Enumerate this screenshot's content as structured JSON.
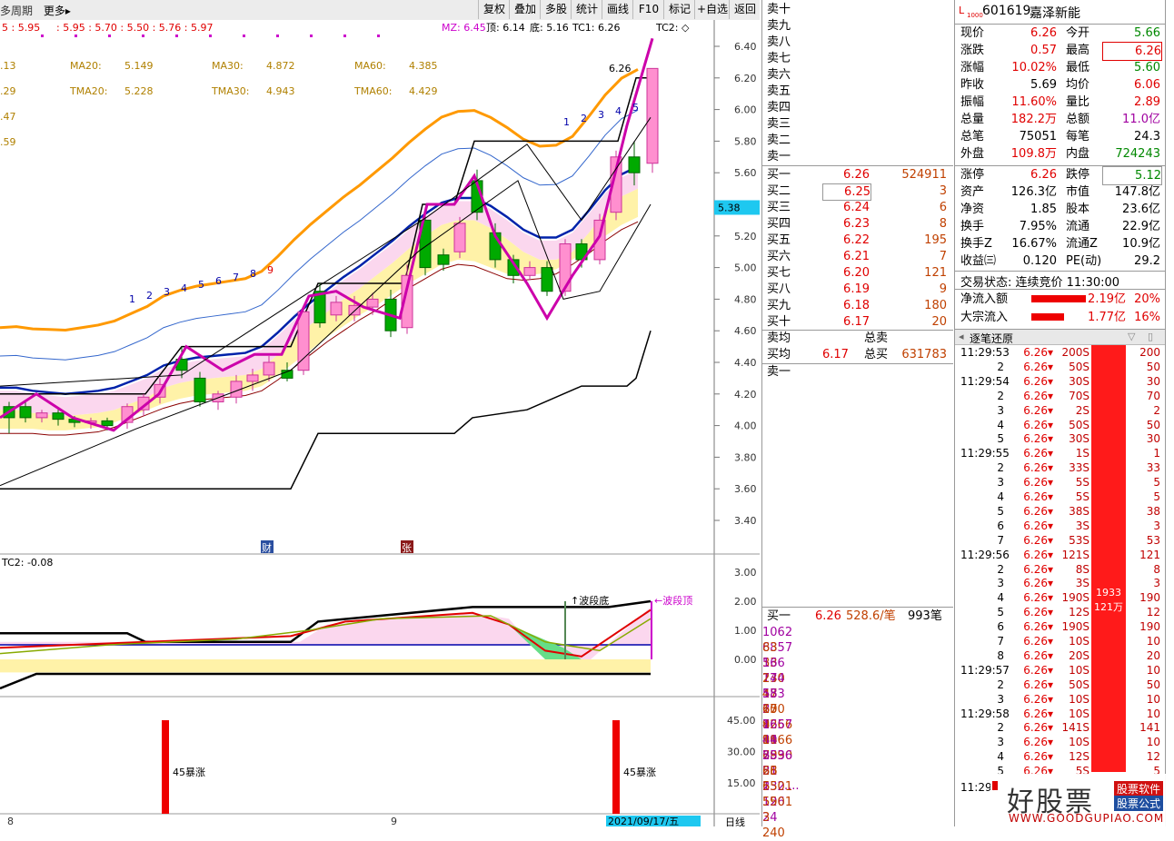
{
  "toolbar": {
    "period": "多周期",
    "more": "更多",
    "buttons": [
      "复权",
      "叠加",
      "多股",
      "统计",
      "画线",
      "F10",
      "标记",
      "+自选",
      "返回"
    ]
  },
  "main_chart": {
    "info_row1": [
      "5 : 5.95",
      ": 5.95 : 5.70 : 5.50 : 5.76 : 5.97",
      "MZ: 6.45",
      "顶: 6.14",
      "底: 5.16",
      "TC1: 6.26",
      "TC2: ◇"
    ],
    "ma_row1": [
      ".13",
      "MA20:",
      "5.149",
      "MA30:",
      "4.872",
      "MA60:",
      "4.385"
    ],
    "ma_row2": [
      ".29",
      "TMA20:",
      "5.228",
      "TMA30:",
      "4.943",
      "TMA60:",
      "4.429"
    ],
    "side_vals": [
      ".47",
      ".59"
    ],
    "price_ticks": [
      "6.40",
      "6.20",
      "6.00",
      "5.80",
      "5.60",
      "5.20",
      "5.00",
      "4.80",
      "4.60",
      "4.40",
      "4.20",
      "4.00",
      "3.80",
      "3.60",
      "3.40"
    ],
    "current_price_tag": "5.38",
    "high_label": "6.26",
    "seq_nums_left": [
      "1",
      "2",
      "3",
      "4",
      "5",
      "6",
      "7",
      "8",
      "9"
    ],
    "seq_nums_right": [
      "1",
      "2",
      "3",
      "4",
      "5"
    ],
    "marker_cai": "财",
    "marker_zhang": "张"
  },
  "sub_chart": {
    "title": "TC2: -0.08",
    "ticks": [
      "3.00",
      "2.00",
      "1.00",
      "0.00"
    ],
    "label_bottom": "波段底",
    "label_top": "波段顶"
  },
  "vol_chart": {
    "ticks": [
      "45.00",
      "30.00",
      "15.00"
    ],
    "label_a": "45暴涨",
    "label_b": "45暴涨",
    "bars": [
      45,
      45
    ]
  },
  "bottom_bar": {
    "date_a": "8",
    "date_b": "9",
    "date_current": "2021/09/17/五",
    "period": "日线"
  },
  "orderbook": {
    "sells": [
      "卖十",
      "卖九",
      "卖八",
      "卖七",
      "卖六",
      "卖五",
      "卖四",
      "卖三",
      "卖二",
      "卖一"
    ],
    "buys": [
      {
        "label": "买一",
        "price": "6.26",
        "vol": "524911"
      },
      {
        "label": "买二",
        "price": "6.25",
        "vol": "3"
      },
      {
        "label": "买三",
        "price": "6.24",
        "vol": "6"
      },
      {
        "label": "买四",
        "price": "6.23",
        "vol": "8"
      },
      {
        "label": "买五",
        "price": "6.22",
        "vol": "195"
      },
      {
        "label": "买六",
        "price": "6.21",
        "vol": "7"
      },
      {
        "label": "买七",
        "price": "6.20",
        "vol": "121"
      },
      {
        "label": "买八",
        "price": "6.19",
        "vol": "9"
      },
      {
        "label": "买九",
        "price": "6.18",
        "vol": "180"
      },
      {
        "label": "买十",
        "price": "6.17",
        "vol": "20"
      }
    ],
    "avg_sell_label": "卖均",
    "total_sell_label": "总卖",
    "avg_buy_label": "买均",
    "avg_buy": "6.17",
    "total_buy_label": "总买",
    "total_buy": "631783",
    "sell1_label": "卖一",
    "queue_header": {
      "label": "买一",
      "price": "6.26",
      "amount": "528.6/笔",
      "count": "993笔"
    },
    "queue_rows": [
      [
        "1062",
        "6857",
        "536",
        "74",
        "133"
      ],
      [
        "83",
        "33",
        "130",
        "47",
        "20"
      ],
      [
        "16",
        "174",
        "55",
        "6",
        "4"
      ],
      [
        "2",
        "48",
        "15",
        "82",
        "81"
      ],
      [
        "58",
        "3",
        "7",
        "39",
        "383"
      ],
      [
        "670",
        "9666",
        "9666",
        "6390",
        "28"
      ],
      [
        "1657",
        "44",
        "5",
        "51",
        "1"
      ],
      [
        "1",
        "79",
        "35",
        "6",
        "59"
      ],
      [
        "2536",
        "8",
        "232",
        "126",
        "24"
      ],
      [
        "66",
        "5501",
        "5501",
        "3",
        "240"
      ]
    ],
    "more": "...."
  },
  "quote": {
    "code": "601619",
    "name": "嘉泽新能",
    "rows": [
      [
        "现价",
        "6.26",
        "今开",
        "5.66"
      ],
      [
        "涨跌",
        "0.57",
        "最高",
        "6.26"
      ],
      [
        "涨幅",
        "10.02%",
        "最低",
        "5.60"
      ],
      [
        "昨收",
        "5.69",
        "均价",
        "6.06"
      ],
      [
        "振幅",
        "11.60%",
        "量比",
        "2.89"
      ],
      [
        "总量",
        "182.2万",
        "总额",
        "11.0亿"
      ],
      [
        "总笔",
        "75051",
        "每笔",
        "24.3"
      ],
      [
        "外盘",
        "109.8万",
        "内盘",
        "724243"
      ],
      [
        "涨停",
        "6.26",
        "跌停",
        "5.12"
      ],
      [
        "资产",
        "126.3亿",
        "市值",
        "147.8亿"
      ],
      [
        "净资",
        "1.85",
        "股本",
        "23.6亿"
      ],
      [
        "换手",
        "7.95%",
        "流通",
        "22.9亿"
      ],
      [
        "换手Z",
        "16.67%",
        "流通Z",
        "10.9亿"
      ],
      [
        "收益㈢",
        "0.120",
        "PE(动)",
        "29.2"
      ]
    ],
    "trade_status": "交易状态: 连续竞价 11:30:00",
    "net_inflow_label": "净流入额",
    "net_inflow": "2.19亿",
    "net_inflow_pct": "20%",
    "block_inflow_label": "大宗流入",
    "block_inflow": "1.77亿",
    "block_inflow_pct": "16%",
    "ticks_title": "逐笔还原",
    "tick_bar_label": "1933",
    "tick_bar_label2": "121万",
    "ticks": [
      [
        "11:29:53",
        "6.26",
        "200S",
        "200"
      ],
      [
        "2",
        "6.26",
        "50S",
        "50"
      ],
      [
        "11:29:54",
        "6.26",
        "30S",
        "30"
      ],
      [
        "2",
        "6.26",
        "70S",
        "70"
      ],
      [
        "3",
        "6.26",
        "2S",
        "2"
      ],
      [
        "4",
        "6.26",
        "50S",
        "50"
      ],
      [
        "5",
        "6.26",
        "30S",
        "30"
      ],
      [
        "11:29:55",
        "6.26",
        "1S",
        "1"
      ],
      [
        "2",
        "6.26",
        "33S",
        "33"
      ],
      [
        "3",
        "6.26",
        "5S",
        "5"
      ],
      [
        "4",
        "6.26",
        "5S",
        "5"
      ],
      [
        "5",
        "6.26",
        "38S",
        "38"
      ],
      [
        "6",
        "6.26",
        "3S",
        "3"
      ],
      [
        "7",
        "6.26",
        "53S",
        "53"
      ],
      [
        "11:29:56",
        "6.26",
        "121S",
        "121"
      ],
      [
        "2",
        "6.26",
        "8S",
        "8"
      ],
      [
        "3",
        "6.26",
        "3S",
        "3"
      ],
      [
        "4",
        "6.26",
        "190S",
        "190"
      ],
      [
        "5",
        "6.26",
        "12S",
        "12"
      ],
      [
        "6",
        "6.26",
        "190S",
        "190"
      ],
      [
        "7",
        "6.26",
        "10S",
        "10"
      ],
      [
        "8",
        "6.26",
        "20S",
        "20"
      ],
      [
        "11:29:57",
        "6.26",
        "10S",
        "10"
      ],
      [
        "2",
        "6.26",
        "50S",
        "50"
      ],
      [
        "3",
        "6.26",
        "10S",
        "10"
      ],
      [
        "11:29:58",
        "6.26",
        "10S",
        "10"
      ],
      [
        "2",
        "6.26",
        "141S",
        "141"
      ],
      [
        "3",
        "6.26",
        "10S",
        "10"
      ],
      [
        "4",
        "6.26",
        "12S",
        "12"
      ],
      [
        "5",
        "6.26",
        "5S",
        "5"
      ]
    ],
    "last_time": "11:29:"
  },
  "watermark": {
    "brand": "好股票",
    "tag1": "股票软件",
    "tag2": "股票公式",
    "url": "WWW.GOODGUPIAO.COM"
  },
  "colors": {
    "up": "#ff3399",
    "down": "#00aa00",
    "ma_orange": "#ff9900",
    "ma_blue": "#0022aa",
    "accent_red": "#e00000",
    "magenta": "#cc00cc"
  }
}
